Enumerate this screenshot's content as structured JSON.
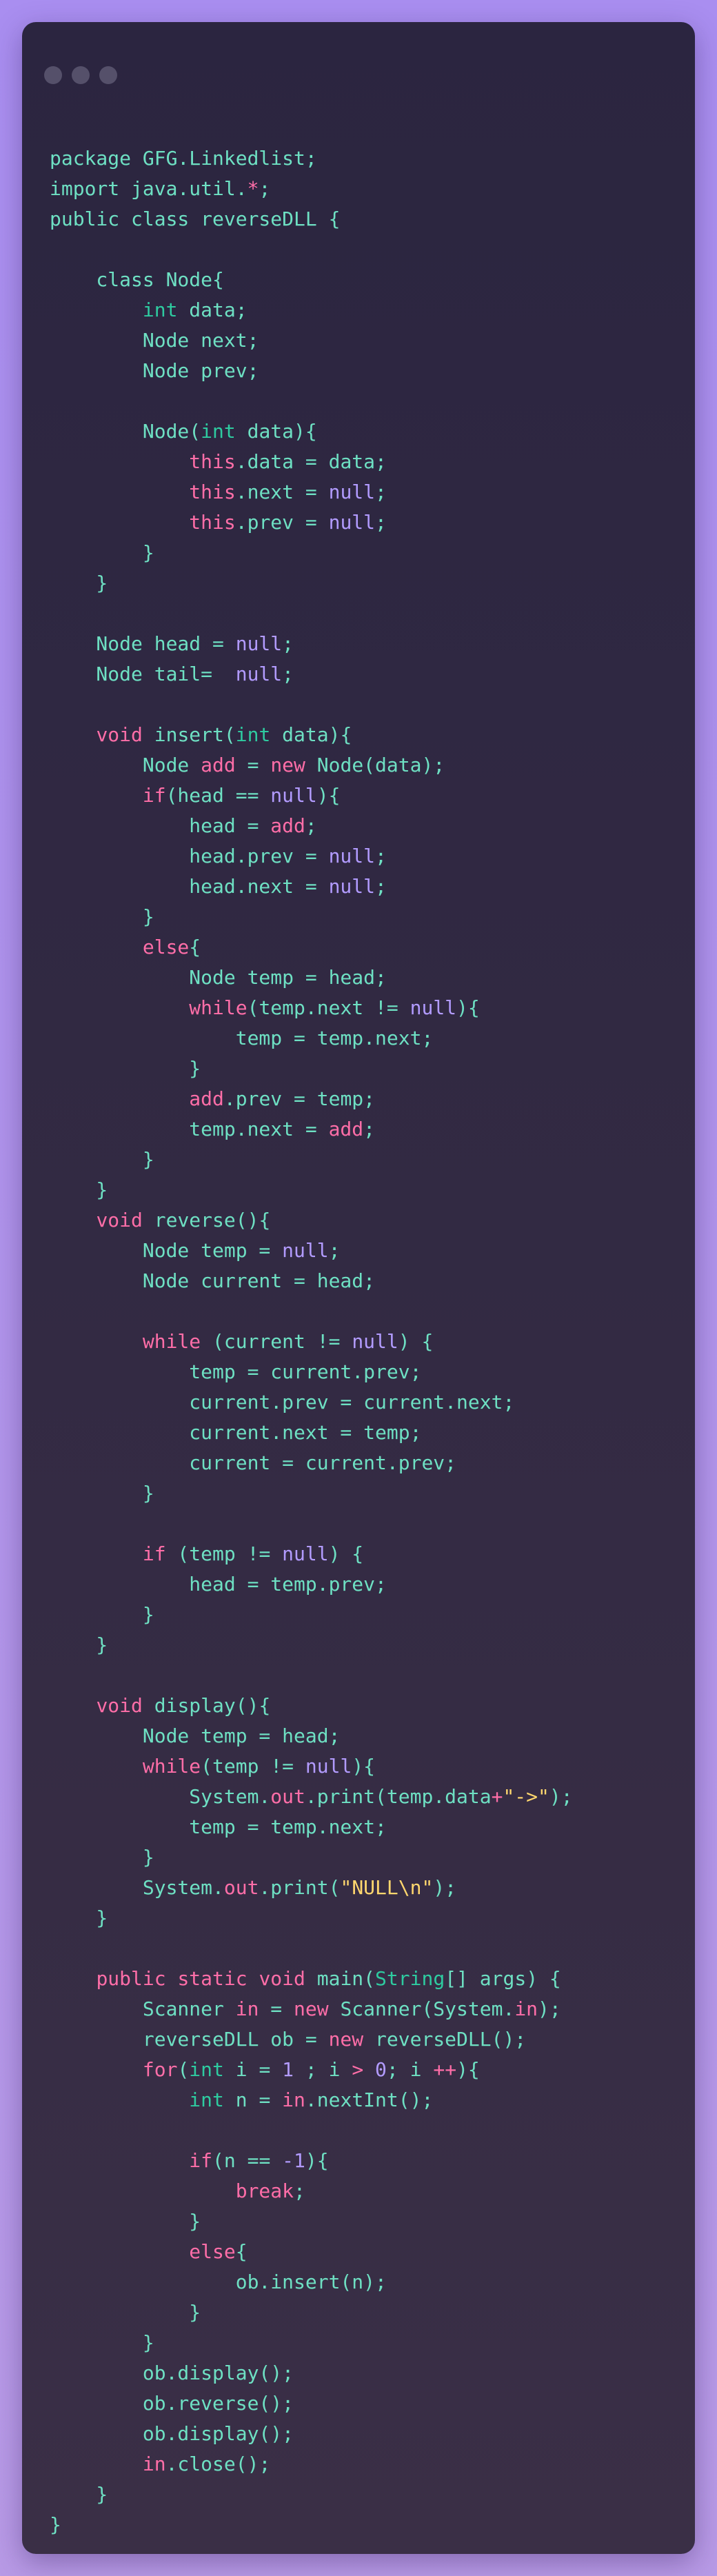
{
  "window": {
    "controls": [
      "close-dot",
      "minimize-dot",
      "maximize-dot"
    ],
    "colors": {
      "background": "#2b2540",
      "plain": "#6ee0c3",
      "keyword": "#ff6ea8",
      "type": "#2ecba0",
      "literal": "#b29bff",
      "string": "#ffd76e",
      "dot": "#55506a"
    }
  },
  "code": {
    "lines": [
      [
        [
          "p",
          "package GFG.Linkedlist;"
        ]
      ],
      [
        [
          "p",
          "import java.util."
        ],
        [
          "k",
          "*"
        ],
        [
          "p",
          ";"
        ]
      ],
      [
        [
          "p",
          "public class reverseDLL {"
        ]
      ],
      [],
      [
        [
          "p",
          "    class Node{"
        ]
      ],
      [
        [
          "p",
          "        "
        ],
        [
          "t",
          "int"
        ],
        [
          "p",
          " data;"
        ]
      ],
      [
        [
          "p",
          "        Node next;"
        ]
      ],
      [
        [
          "p",
          "        Node prev;"
        ]
      ],
      [],
      [
        [
          "p",
          "        Node("
        ],
        [
          "t",
          "int"
        ],
        [
          "p",
          " data){"
        ]
      ],
      [
        [
          "p",
          "            "
        ],
        [
          "k",
          "this"
        ],
        [
          "p",
          ".data = data;"
        ]
      ],
      [
        [
          "p",
          "            "
        ],
        [
          "k",
          "this"
        ],
        [
          "p",
          ".next = "
        ],
        [
          "n",
          "null"
        ],
        [
          "p",
          ";"
        ]
      ],
      [
        [
          "p",
          "            "
        ],
        [
          "k",
          "this"
        ],
        [
          "p",
          ".prev = "
        ],
        [
          "n",
          "null"
        ],
        [
          "p",
          ";"
        ]
      ],
      [
        [
          "p",
          "        }"
        ]
      ],
      [
        [
          "p",
          "    }"
        ]
      ],
      [],
      [
        [
          "p",
          "    Node head = "
        ],
        [
          "n",
          "null"
        ],
        [
          "p",
          ";"
        ]
      ],
      [
        [
          "p",
          "    Node tail=  "
        ],
        [
          "n",
          "null"
        ],
        [
          "p",
          ";"
        ]
      ],
      [],
      [
        [
          "p",
          "    "
        ],
        [
          "k",
          "void"
        ],
        [
          "p",
          " insert("
        ],
        [
          "t",
          "int"
        ],
        [
          "p",
          " data){"
        ]
      ],
      [
        [
          "p",
          "        Node "
        ],
        [
          "k",
          "add"
        ],
        [
          "p",
          " = "
        ],
        [
          "k",
          "new"
        ],
        [
          "p",
          " Node(data);"
        ]
      ],
      [
        [
          "p",
          "        "
        ],
        [
          "k",
          "if"
        ],
        [
          "p",
          "(head == "
        ],
        [
          "n",
          "null"
        ],
        [
          "p",
          "){"
        ]
      ],
      [
        [
          "p",
          "            head = "
        ],
        [
          "k",
          "add"
        ],
        [
          "p",
          ";"
        ]
      ],
      [
        [
          "p",
          "            head.prev = "
        ],
        [
          "n",
          "null"
        ],
        [
          "p",
          ";"
        ]
      ],
      [
        [
          "p",
          "            head.next = "
        ],
        [
          "n",
          "null"
        ],
        [
          "p",
          ";"
        ]
      ],
      [
        [
          "p",
          "        }"
        ]
      ],
      [
        [
          "p",
          "        "
        ],
        [
          "k",
          "else"
        ],
        [
          "p",
          "{"
        ]
      ],
      [
        [
          "p",
          "            Node temp = head;"
        ]
      ],
      [
        [
          "p",
          "            "
        ],
        [
          "k",
          "while"
        ],
        [
          "p",
          "(temp.next != "
        ],
        [
          "n",
          "null"
        ],
        [
          "p",
          "){"
        ]
      ],
      [
        [
          "p",
          "                temp = temp.next;"
        ]
      ],
      [
        [
          "p",
          "            }"
        ]
      ],
      [
        [
          "p",
          "            "
        ],
        [
          "k",
          "add"
        ],
        [
          "p",
          ".prev = temp;"
        ]
      ],
      [
        [
          "p",
          "            temp.next = "
        ],
        [
          "k",
          "add"
        ],
        [
          "p",
          ";"
        ]
      ],
      [
        [
          "p",
          "        }"
        ]
      ],
      [
        [
          "p",
          "    }"
        ]
      ],
      [
        [
          "p",
          "    "
        ],
        [
          "k",
          "void"
        ],
        [
          "p",
          " reverse(){"
        ]
      ],
      [
        [
          "p",
          "        Node temp = "
        ],
        [
          "n",
          "null"
        ],
        [
          "p",
          ";"
        ]
      ],
      [
        [
          "p",
          "        Node current = head;"
        ]
      ],
      [],
      [
        [
          "p",
          "        "
        ],
        [
          "k",
          "while"
        ],
        [
          "p",
          " (current != "
        ],
        [
          "n",
          "null"
        ],
        [
          "p",
          ") {"
        ]
      ],
      [
        [
          "p",
          "            temp = current.prev;"
        ]
      ],
      [
        [
          "p",
          "            current.prev = current.next;"
        ]
      ],
      [
        [
          "p",
          "            current.next = temp;"
        ]
      ],
      [
        [
          "p",
          "            current = current.prev;"
        ]
      ],
      [
        [
          "p",
          "        }"
        ]
      ],
      [],
      [
        [
          "p",
          "        "
        ],
        [
          "k",
          "if"
        ],
        [
          "p",
          " (temp != "
        ],
        [
          "n",
          "null"
        ],
        [
          "p",
          ") {"
        ]
      ],
      [
        [
          "p",
          "            head = temp.prev;"
        ]
      ],
      [
        [
          "p",
          "        }"
        ]
      ],
      [
        [
          "p",
          "    }"
        ]
      ],
      [],
      [
        [
          "p",
          "    "
        ],
        [
          "k",
          "void"
        ],
        [
          "p",
          " display(){"
        ]
      ],
      [
        [
          "p",
          "        Node temp = head;"
        ]
      ],
      [
        [
          "p",
          "        "
        ],
        [
          "k",
          "while"
        ],
        [
          "p",
          "(temp != "
        ],
        [
          "n",
          "null"
        ],
        [
          "p",
          "){"
        ]
      ],
      [
        [
          "p",
          "            System."
        ],
        [
          "k",
          "out"
        ],
        [
          "p",
          ".print(temp.data"
        ],
        [
          "k",
          "+"
        ],
        [
          "s",
          "\"->\""
        ],
        [
          "p",
          ");"
        ]
      ],
      [
        [
          "p",
          "            temp = temp.next;"
        ]
      ],
      [
        [
          "p",
          "        }"
        ]
      ],
      [
        [
          "p",
          "        System."
        ],
        [
          "k",
          "out"
        ],
        [
          "p",
          ".print("
        ],
        [
          "s",
          "\"NULL\\n\""
        ],
        [
          "p",
          ");"
        ]
      ],
      [
        [
          "p",
          "    }"
        ]
      ],
      [],
      [
        [
          "p",
          "    "
        ],
        [
          "k",
          "public static void"
        ],
        [
          "p",
          " main("
        ],
        [
          "t",
          "String"
        ],
        [
          "p",
          "[] args) {"
        ]
      ],
      [
        [
          "p",
          "        Scanner "
        ],
        [
          "k",
          "in"
        ],
        [
          "p",
          " = "
        ],
        [
          "k",
          "new"
        ],
        [
          "p",
          " Scanner(System."
        ],
        [
          "k",
          "in"
        ],
        [
          "p",
          ");"
        ]
      ],
      [
        [
          "p",
          "        reverseDLL ob = "
        ],
        [
          "k",
          "new"
        ],
        [
          "p",
          " reverseDLL();"
        ]
      ],
      [
        [
          "p",
          "        "
        ],
        [
          "k",
          "for"
        ],
        [
          "p",
          "("
        ],
        [
          "t",
          "int"
        ],
        [
          "p",
          " i = "
        ],
        [
          "n",
          "1"
        ],
        [
          "p",
          " ; i "
        ],
        [
          "k",
          ">"
        ],
        [
          "p",
          " "
        ],
        [
          "n",
          "0"
        ],
        [
          "p",
          "; i "
        ],
        [
          "k",
          "++"
        ],
        [
          "p",
          "){"
        ]
      ],
      [
        [
          "p",
          "            "
        ],
        [
          "t",
          "int"
        ],
        [
          "p",
          " n = "
        ],
        [
          "k",
          "in"
        ],
        [
          "p",
          ".nextInt();"
        ]
      ],
      [],
      [
        [
          "p",
          "            "
        ],
        [
          "k",
          "if"
        ],
        [
          "p",
          "(n == "
        ],
        [
          "n",
          "-1"
        ],
        [
          "p",
          "){"
        ]
      ],
      [
        [
          "p",
          "                "
        ],
        [
          "k",
          "break"
        ],
        [
          "p",
          ";"
        ]
      ],
      [
        [
          "p",
          "            }"
        ]
      ],
      [
        [
          "p",
          "            "
        ],
        [
          "k",
          "else"
        ],
        [
          "p",
          "{"
        ]
      ],
      [
        [
          "p",
          "                ob.insert(n);"
        ]
      ],
      [
        [
          "p",
          "            }"
        ]
      ],
      [
        [
          "p",
          "        }"
        ]
      ],
      [
        [
          "p",
          "        ob.display();"
        ]
      ],
      [
        [
          "p",
          "        ob.reverse();"
        ]
      ],
      [
        [
          "p",
          "        ob.display();"
        ]
      ],
      [
        [
          "p",
          "        "
        ],
        [
          "k",
          "in"
        ],
        [
          "p",
          ".close();"
        ]
      ],
      [
        [
          "p",
          "    }"
        ]
      ],
      [
        [
          "p",
          "}"
        ]
      ]
    ]
  }
}
